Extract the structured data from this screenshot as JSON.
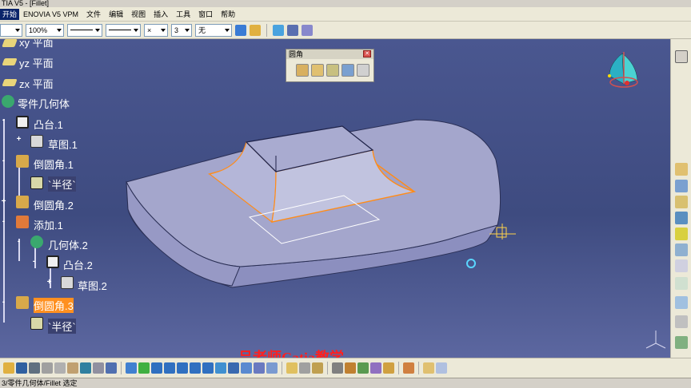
{
  "window": {
    "title": "TIA V5 - [Fillet]"
  },
  "menu": {
    "active": "开始",
    "items": [
      "ENOVIA V5 VPM",
      "文件",
      "编辑",
      "视图",
      "插入",
      "工具",
      "窗口",
      "帮助"
    ]
  },
  "toolbar_top": {
    "zoom_value": "100%",
    "layer_value": "无",
    "point_value": "×",
    "number_value": "3"
  },
  "tree": {
    "xy_plane": "xy 平面",
    "yz_plane": "yz 平面",
    "zx_plane": "zx 平面",
    "part_body": "零件几何体",
    "pad1": "凸台.1",
    "sketch1": "草图.1",
    "fillet1": "倒圆角.1",
    "fillet1_radius": "`半径`",
    "fillet2": "倒圆角.2",
    "add1": "添加.1",
    "body2": "几何体.2",
    "pad2": "凸台.2",
    "sketch2": "草图.2",
    "fillet3": "倒圆角.3",
    "fillet3_radius": "`半径`"
  },
  "fillet_toolbar": {
    "title": "圆角"
  },
  "watermark": "吕老师Catia教学",
  "status": "3/零件几何体/Fillet 选定",
  "colors": {
    "viewport_bg": "#3f4d7e",
    "tree_text": "#ffffff",
    "selection_highlight": "#ff9020",
    "accent_orange": "#ff8c1a",
    "part_face": "#a4a6cc"
  },
  "icons": [
    "compass-icon",
    "axis-icon",
    "save-icon",
    "open-icon",
    "undo-icon",
    "zoom-icon",
    "pan-icon",
    "rotate-icon",
    "fillet-icon"
  ]
}
